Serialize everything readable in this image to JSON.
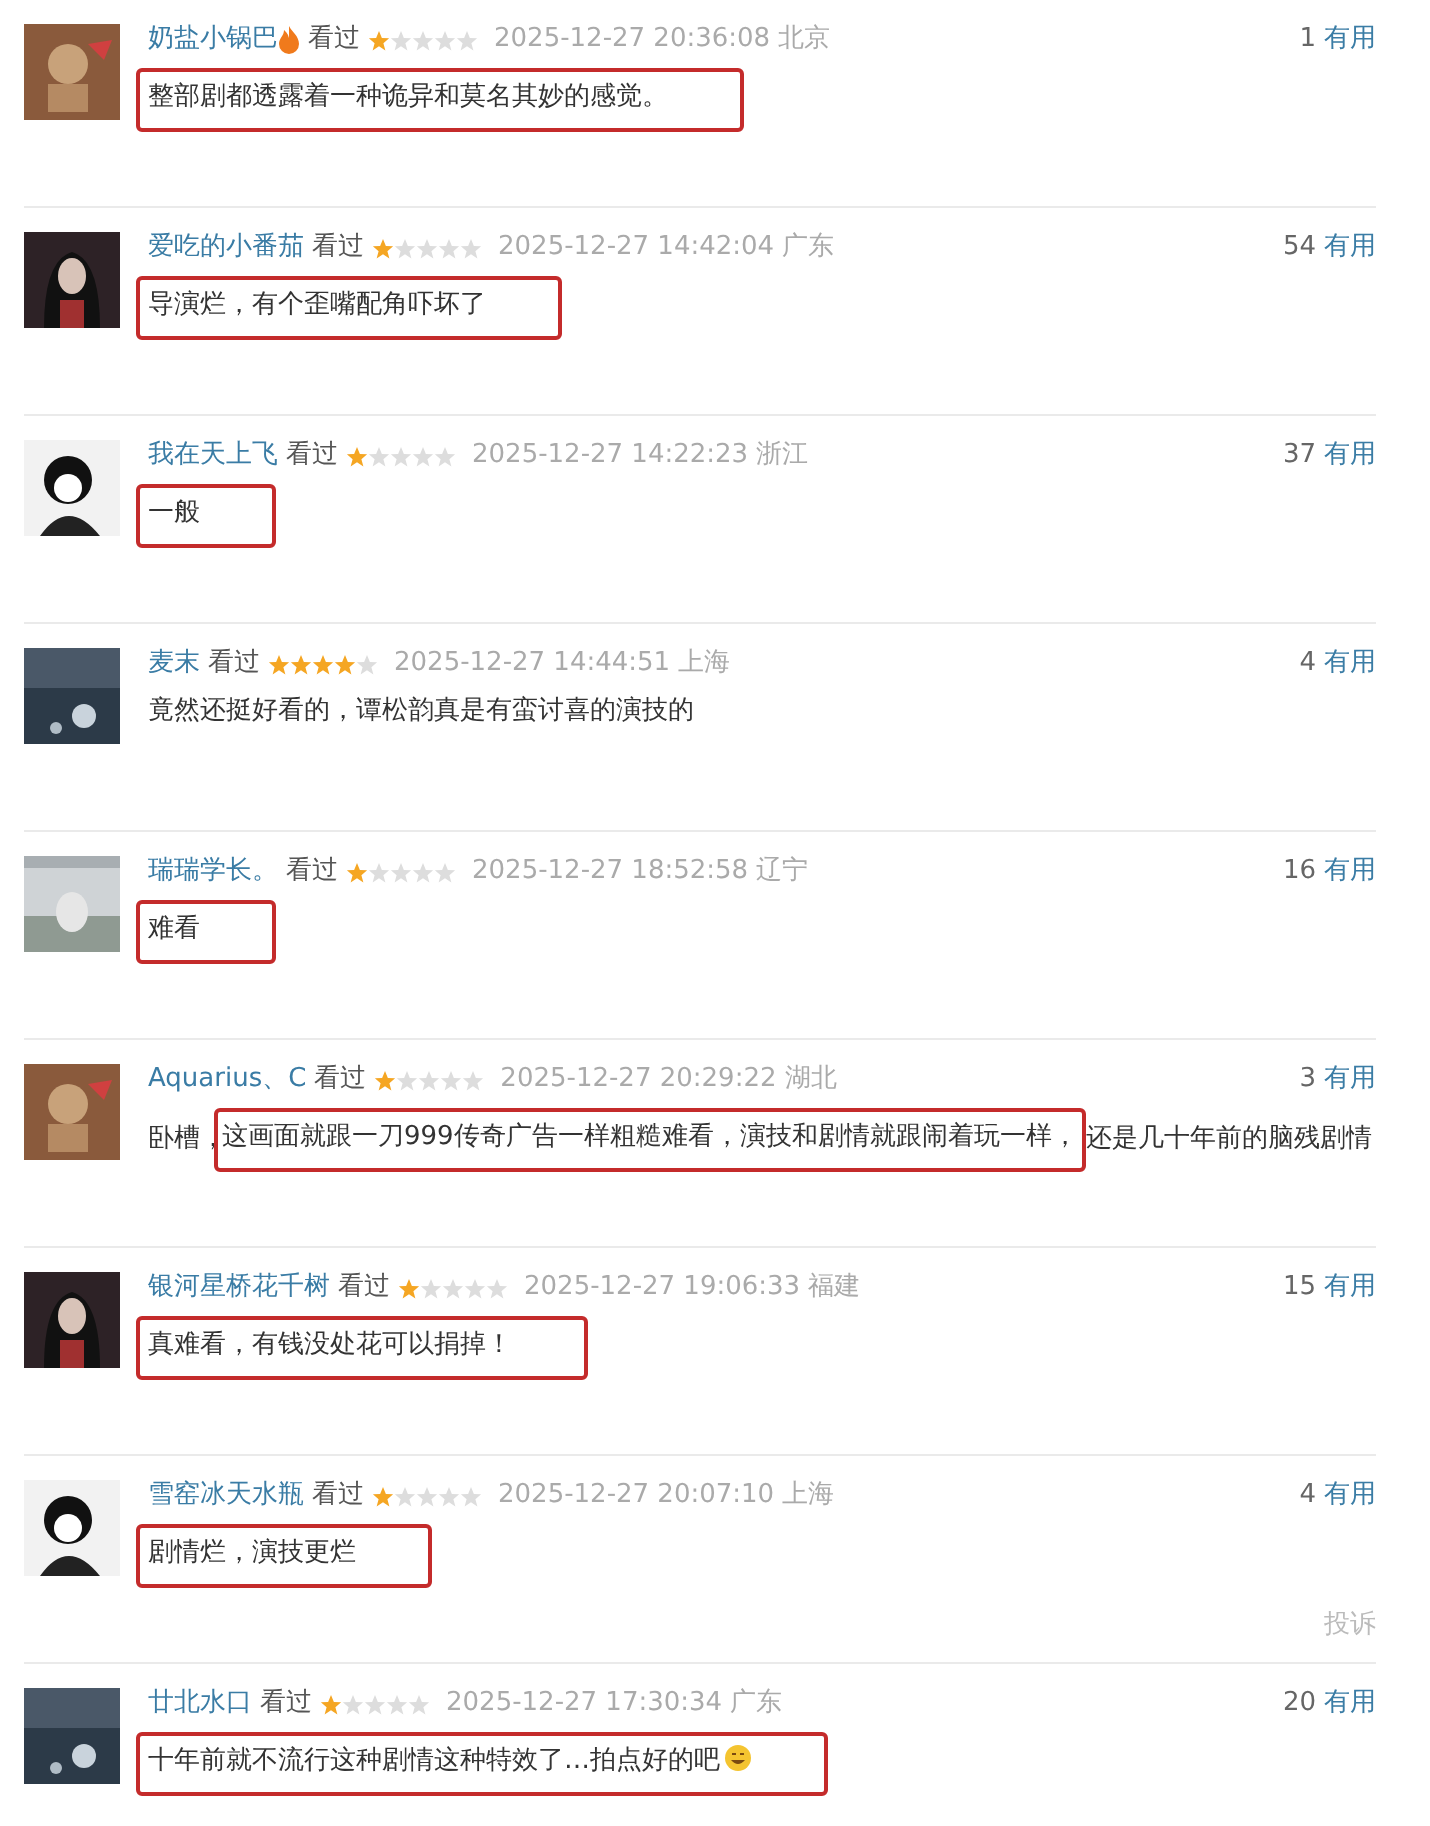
{
  "comments": [
    {
      "name": "奶盐小锅巴",
      "flame_badge": true,
      "status": "看过",
      "stars": 1,
      "time": "2025-12-27 20:36:08",
      "region": "北京",
      "votes": "1",
      "vote_label": "有用",
      "comment": [
        {
          "text": "整部剧都透露着一种诡异和莫名其妙的感觉。",
          "highlighted": true
        }
      ]
    },
    {
      "name": "爱吃的小番茄",
      "flame_badge": false,
      "status": "看过",
      "stars": 1,
      "time": "2025-12-27 14:42:04",
      "region": "广东",
      "votes": "54",
      "vote_label": "有用",
      "comment": [
        {
          "text": "导演烂，有个歪嘴配角吓坏了",
          "highlighted": true
        }
      ]
    },
    {
      "name": "我在天上飞",
      "flame_badge": false,
      "status": "看过",
      "stars": 1,
      "time": "2025-12-27 14:22:23",
      "region": "浙江",
      "votes": "37",
      "vote_label": "有用",
      "comment": [
        {
          "text": "一般",
          "highlighted": true
        }
      ]
    },
    {
      "name": "麦末",
      "flame_badge": false,
      "status": "看过",
      "stars": 4,
      "time": "2025-12-27 14:44:51",
      "region": "上海",
      "votes": "4",
      "vote_label": "有用",
      "comment": [
        {
          "text": "竟然还挺好看的，谭松韵真是有蛮讨喜的演技的",
          "highlighted": false
        }
      ]
    },
    {
      "name": "瑞瑞学长。",
      "flame_badge": false,
      "status": "看过",
      "stars": 1,
      "time": "2025-12-27 18:52:58",
      "region": "辽宁",
      "votes": "16",
      "vote_label": "有用",
      "comment": [
        {
          "text": "难看",
          "highlighted": true
        }
      ]
    },
    {
      "name": "Aquarius、C",
      "flame_badge": false,
      "status": "看过",
      "stars": 1,
      "time": "2025-12-27 20:29:22",
      "region": "湖北",
      "votes": "3",
      "vote_label": "有用",
      "comment": [
        {
          "text": "卧槽，",
          "highlighted": false
        },
        {
          "text": "这画面就跟一刀999传奇广告一样粗糙难看，演技和剧情就跟闹着玩一样，",
          "highlighted": true
        },
        {
          "text": "还是几十年前的脑残剧情",
          "highlighted": false
        }
      ]
    },
    {
      "name": "银河星桥花千树",
      "flame_badge": false,
      "status": "看过",
      "stars": 1,
      "time": "2025-12-27 19:06:33",
      "region": "福建",
      "votes": "15",
      "vote_label": "有用",
      "comment": [
        {
          "text": "真难看，有钱没处花可以捐掉！",
          "highlighted": true
        }
      ]
    },
    {
      "name": "雪窑冰天水瓶",
      "flame_badge": false,
      "status": "看过",
      "stars": 1,
      "time": "2025-12-27 20:07:10",
      "region": "上海",
      "votes": "4",
      "vote_label": "有用",
      "comment": [
        {
          "text": "剧情烂，演技更烂",
          "highlighted": true
        }
      ],
      "report": "投诉"
    },
    {
      "name": "廿北水口",
      "flame_badge": false,
      "status": "看过",
      "stars": 1,
      "time": "2025-12-27 17:30:34",
      "region": "广东",
      "votes": "20",
      "vote_label": "有用",
      "comment": [
        {
          "text": "十年前就不流行这种剧情这种特效了…拍点好的吧",
          "highlighted": true
        }
      ],
      "emoji": true
    }
  ]
}
